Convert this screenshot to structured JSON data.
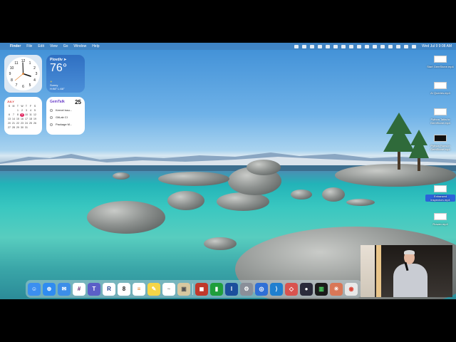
{
  "menubar": {
    "apple": "",
    "items": [
      "Finder",
      "File",
      "Edit",
      "View",
      "Go",
      "Window",
      "Help"
    ],
    "clock": "Wed Jul 9  9:08 AM"
  },
  "widgets": {
    "clock": {
      "numbers": [
        "12",
        "1",
        "2",
        "3",
        "4",
        "5",
        "6",
        "7",
        "8",
        "9",
        "10",
        "11"
      ]
    },
    "weather": {
      "city": "Plovdiv ➤",
      "temp": "76°",
      "condition": "Sunny",
      "highlow": "H:98° L:66°"
    },
    "calendar": {
      "month": "JULY",
      "weekdays": [
        "S",
        "M",
        "T",
        "W",
        "T",
        "F",
        "S"
      ],
      "days": [
        "",
        "",
        "1",
        "2",
        "3",
        "4",
        "5",
        "6",
        "7",
        "8",
        "9",
        "10",
        "11",
        "12",
        "13",
        "14",
        "15",
        "16",
        "17",
        "18",
        "19",
        "20",
        "21",
        "22",
        "23",
        "24",
        "25",
        "26",
        "27",
        "28",
        "29",
        "30",
        "31",
        "",
        ""
      ],
      "today": "9"
    },
    "gemtalk": {
      "title": "GemTalk",
      "count": "25",
      "items": [
        "Kernel issu...",
        "GitLab CI",
        "Package M..."
      ]
    }
  },
  "desktop_icons": [
    {
      "label": "Start GemStone.mp4",
      "dark": false,
      "selected": false
    },
    {
      "label": "AI Queries.mp4",
      "dark": false,
      "selected": false
    },
    {
      "label": "Python Talks to GemStone.mp4",
      "dark": false,
      "selected": false
    },
    {
      "label": "Python Runs in GemStone.mp4",
      "dark": true,
      "selected": false
    },
    {
      "label": "Enhanced Inspectors.mp4",
      "dark": false,
      "selected": true
    },
    {
      "label": "Rowan.mp4",
      "dark": false,
      "selected": false
    }
  ],
  "dock": {
    "apps": [
      {
        "name": "finder",
        "glyph": "☺",
        "color": "#3b8ff0"
      },
      {
        "name": "safari",
        "glyph": "⊕",
        "color": "#2f8cf0"
      },
      {
        "name": "mail",
        "glyph": "✉",
        "color": "#3c8ee8"
      },
      {
        "name": "slack",
        "glyph": "#",
        "color": "#ffffff"
      },
      {
        "name": "teams",
        "glyph": "T",
        "color": "#5b5fc7"
      },
      {
        "name": "rider",
        "glyph": "R",
        "color": "#ffffff"
      },
      {
        "name": "calendar",
        "glyph": "8",
        "color": "#ffffff"
      },
      {
        "name": "reminders",
        "glyph": "≡",
        "color": "#ffffff"
      },
      {
        "name": "notes",
        "glyph": "✎",
        "color": "#f5d547"
      },
      {
        "name": "freeform",
        "glyph": "~",
        "color": "#ffffff"
      },
      {
        "name": "preview",
        "glyph": "▣",
        "color": "#d8c8a0"
      },
      {
        "name": "photo-booth",
        "glyph": "◼",
        "color": "#c0392b"
      },
      {
        "name": "numbers",
        "glyph": "▮",
        "color": "#1f9e3c"
      },
      {
        "name": "instruments",
        "glyph": "I",
        "color": "#1b4f9c"
      },
      {
        "name": "system-settings",
        "glyph": "⚙",
        "color": "#8a8f99"
      },
      {
        "name": "signal",
        "glyph": "◎",
        "color": "#2f6fd6"
      },
      {
        "name": "vscode",
        "glyph": "⟩",
        "color": "#1f7fd0"
      },
      {
        "name": "parallels",
        "glyph": "◇",
        "color": "#d9534f"
      },
      {
        "name": "obs",
        "glyph": "●",
        "color": "#2a2a3a"
      },
      {
        "name": "activity-monitor",
        "glyph": "▥",
        "color": "#1a1a1a"
      },
      {
        "name": "claude",
        "glyph": "✳",
        "color": "#d97757"
      },
      {
        "name": "chrome",
        "glyph": "◉",
        "color": "#e8e8e8"
      }
    ]
  }
}
